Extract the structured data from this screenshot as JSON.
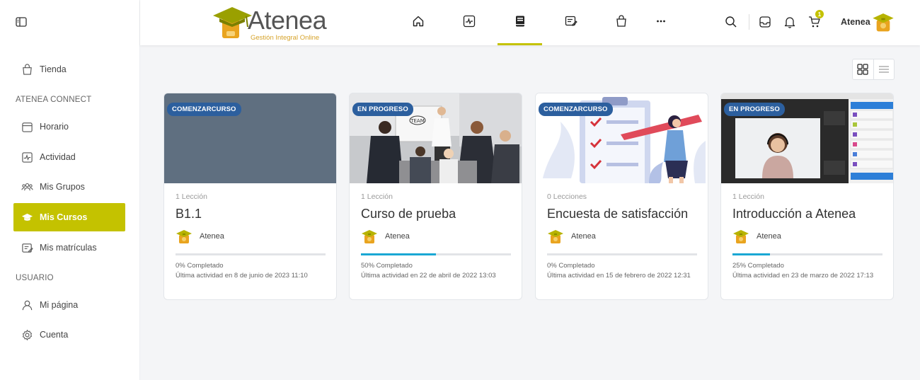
{
  "sidebar": {
    "items": [
      {
        "label": "Tienda",
        "icon": "shop-bag-icon"
      },
      {
        "label": "Horario",
        "icon": "calendar-icon"
      },
      {
        "label": "Actividad",
        "icon": "activity-icon"
      },
      {
        "label": "Mis Grupos",
        "icon": "groups-icon"
      },
      {
        "label": "Mis Cursos",
        "icon": "graduation-cap-icon",
        "active": true
      },
      {
        "label": "Mis matrículas",
        "icon": "enrollment-icon"
      },
      {
        "label": "Mi página",
        "icon": "user-icon"
      },
      {
        "label": "Cuenta",
        "icon": "gear-icon"
      }
    ],
    "sections": [
      "ATENEA CONNECT",
      "USUARIO"
    ]
  },
  "header": {
    "logo_word": "Atenea",
    "logo_sub": "Gestión Integral Online",
    "cart_count": "1",
    "user_name": "Atenea",
    "accent_color": "#c4c200"
  },
  "courses": [
    {
      "badge": "COMENZARCURSO",
      "lessons": "1 Lección",
      "title": "B1.1",
      "author": "Atenea",
      "progress": 0,
      "pct_label": "0% Completado",
      "last_activity": "Última actividad en 8 de junio de 2023 11:10"
    },
    {
      "badge": "EN PROGRESO",
      "lessons": "1 Lección",
      "title": "Curso de prueba",
      "author": "Atenea",
      "progress": 50,
      "pct_label": "50% Completado",
      "last_activity": "Última actividad en 22 de abril de 2022 13:03"
    },
    {
      "badge": "COMENZARCURSO",
      "lessons": "0 Lecciones",
      "title": "Encuesta de satisfacción",
      "author": "Atenea",
      "progress": 0,
      "pct_label": "0% Completado",
      "last_activity": "Última actividad en 15 de febrero de 2022 12:31"
    },
    {
      "badge": "EN PROGRESO",
      "lessons": "1 Lección",
      "title": "Introducción a Atenea",
      "author": "Atenea",
      "progress": 25,
      "pct_label": "25% Completado",
      "last_activity": "Última actividad en 23 de marzo de 2022 17:13"
    }
  ],
  "photo_text": {
    "whiteboard_word": "TEAM"
  }
}
